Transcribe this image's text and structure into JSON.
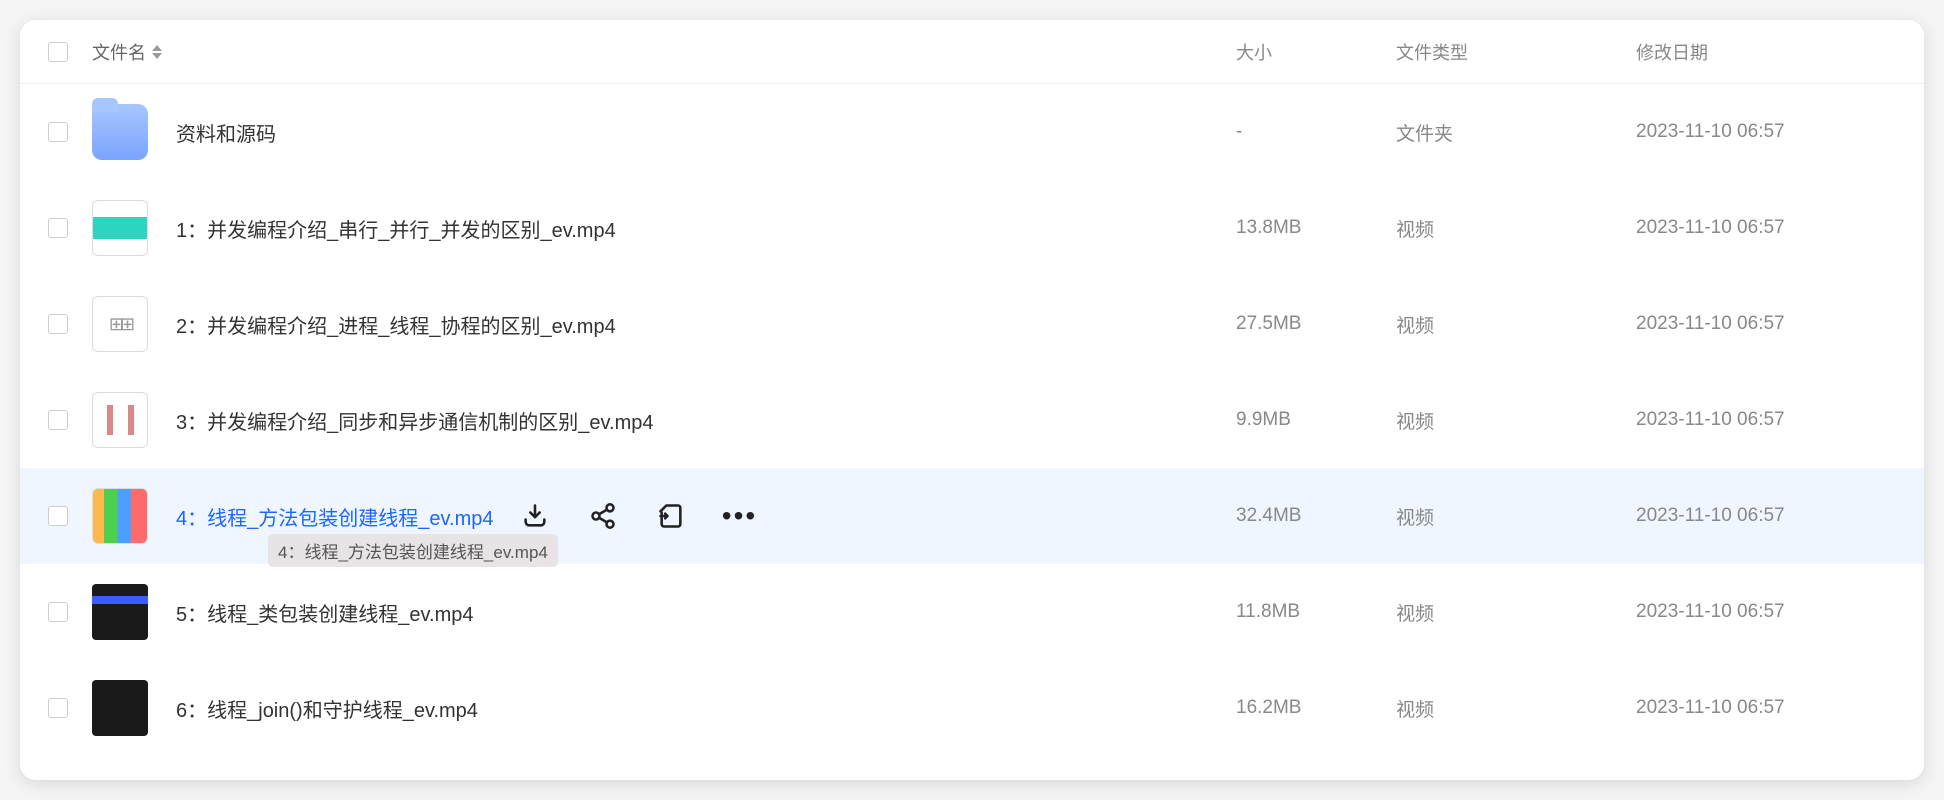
{
  "header": {
    "name": "文件名",
    "size": "大小",
    "type": "文件类型",
    "date": "修改日期"
  },
  "tooltip": "4：线程_方法包装创建线程_ev.mp4",
  "rows": [
    {
      "name": "资料和源码",
      "size": "-",
      "type": "文件夹",
      "date": "2023-11-10 06:57",
      "thumb": "folder",
      "hovered": false
    },
    {
      "name": "1：并发编程介绍_串行_并行_并发的区别_ev.mp4",
      "size": "13.8MB",
      "type": "视频",
      "date": "2023-11-10 06:57",
      "thumb": "video1",
      "hovered": false
    },
    {
      "name": "2：并发编程介绍_进程_线程_协程的区别_ev.mp4",
      "size": "27.5MB",
      "type": "视频",
      "date": "2023-11-10 06:57",
      "thumb": "video2",
      "hovered": false
    },
    {
      "name": "3：并发编程介绍_同步和异步通信机制的区别_ev.mp4",
      "size": "9.9MB",
      "type": "视频",
      "date": "2023-11-10 06:57",
      "thumb": "video3",
      "hovered": false
    },
    {
      "name": "4：线程_方法包装创建线程_ev.mp4",
      "size": "32.4MB",
      "type": "视频",
      "date": "2023-11-10 06:57",
      "thumb": "video4",
      "hovered": true
    },
    {
      "name": "5：线程_类包装创建线程_ev.mp4",
      "size": "11.8MB",
      "type": "视频",
      "date": "2023-11-10 06:57",
      "thumb": "video5",
      "hovered": false
    },
    {
      "name": "6：线程_join()和守护线程_ev.mp4",
      "size": "16.2MB",
      "type": "视频",
      "date": "2023-11-10 06:57",
      "thumb": "video6",
      "hovered": false
    }
  ]
}
